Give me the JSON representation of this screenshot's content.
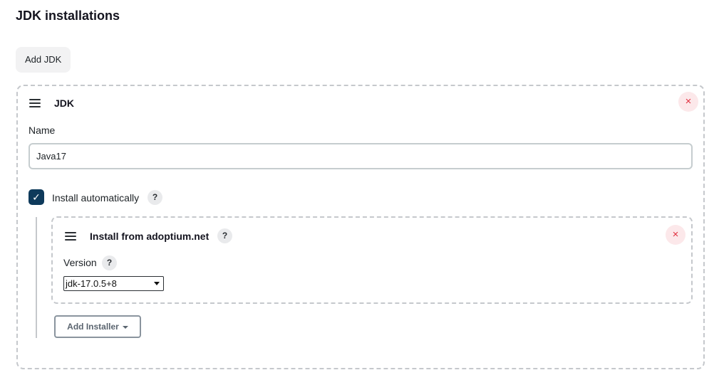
{
  "section": {
    "title": "JDK installations"
  },
  "add_jdk_label": "Add JDK",
  "jdk_card": {
    "title": "JDK",
    "close_glyph": "×",
    "name_label": "Name",
    "name_value": "Java17",
    "install_auto": {
      "label": "Install automatically",
      "checked": true,
      "check_glyph": "✓"
    },
    "installer": {
      "title": "Install from adoptium.net",
      "close_glyph": "×",
      "version_label": "Version",
      "version_selected": "jdk-17.0.5+8"
    },
    "add_installer_label": "Add Installer"
  },
  "help_glyph": "?",
  "icons": [
    "drag-handle-icon",
    "close-icon",
    "check-icon",
    "help-icon",
    "caret-down-icon"
  ],
  "colors": {
    "checkbox": "#0e3a5b",
    "close_bg": "#fce8ea",
    "close_fg": "#e0303f",
    "border": "#c5c8cc"
  }
}
